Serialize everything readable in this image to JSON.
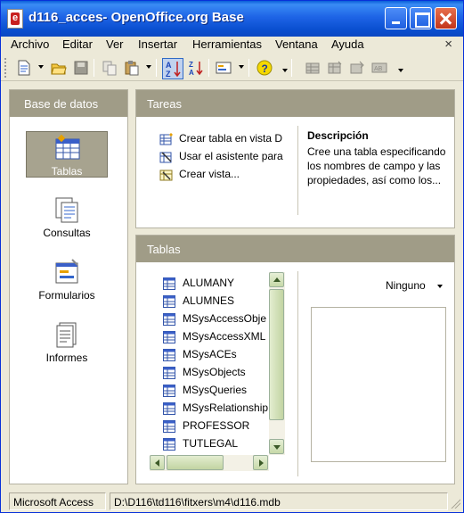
{
  "window": {
    "title": "d116_acces- OpenOffice.org Base",
    "title_bar_color": "#0A5FD8"
  },
  "menubar": {
    "items": [
      "Archivo",
      "Editar",
      "Ver",
      "Insertar",
      "Herramientas",
      "Ventana",
      "Ayuda"
    ],
    "close_glyph": "×"
  },
  "toolbar": {
    "icons": [
      "new-document-icon",
      "open-folder-icon",
      "save-icon",
      "copy-icon",
      "paste-icon",
      "sort-ascending-icon",
      "sort-descending-icon",
      "form-icon",
      "help-icon",
      "table-edit-icon",
      "table-new-icon",
      "query-icon",
      "report-icon"
    ]
  },
  "left_panel": {
    "header": "Base de datos",
    "items": [
      {
        "label": "Tablas",
        "icon": "table-icon",
        "active": true
      },
      {
        "label": "Consultas",
        "icon": "query-icon",
        "active": false
      },
      {
        "label": "Formularios",
        "icon": "form-icon",
        "active": false
      },
      {
        "label": "Informes",
        "icon": "report-icon",
        "active": false
      }
    ]
  },
  "tasks_panel": {
    "header": "Tareas",
    "tasks": [
      {
        "label": "Crear tabla en vista D",
        "icon": "create-table-design-icon"
      },
      {
        "label": "Usar el asistente para",
        "icon": "table-wizard-icon"
      },
      {
        "label": "Crear vista...",
        "icon": "create-view-icon"
      }
    ],
    "description_title": "Descripción",
    "description_text": "Cree una tabla especificando los nombres de campo y las propiedades, así como los..."
  },
  "tables_panel": {
    "header": "Tablas",
    "tables": [
      "ALUMANY",
      "ALUMNES",
      "MSysAccessObje",
      "MSysAccessXML",
      "MSysACEs",
      "MSysObjects",
      "MSysQueries",
      "MSysRelationship",
      "PROFESSOR",
      "TUTLEGAL"
    ],
    "preview_mode": "Ninguno"
  },
  "statusbar": {
    "connection": "Microsoft Access",
    "path": "D:\\D116\\td116\\fitxers\\m4\\d116.mdb"
  },
  "colors": {
    "panel_header": "#A09C87",
    "window_bg": "#ECE9D8",
    "scrollbar": "#C7D9A8"
  }
}
